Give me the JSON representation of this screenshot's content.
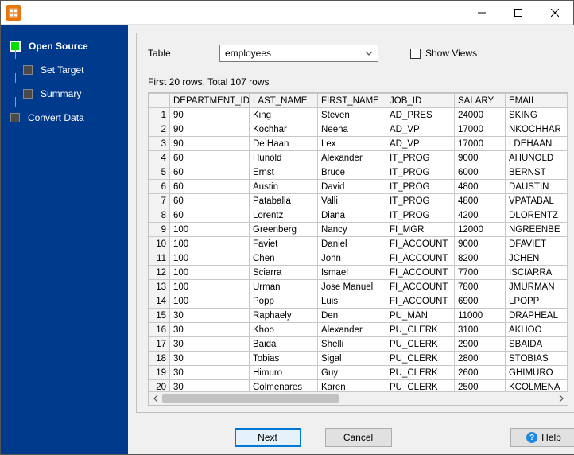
{
  "sidebar": {
    "steps": [
      {
        "label": "Open Source",
        "active": true,
        "indent": false
      },
      {
        "label": "Set Target",
        "active": false,
        "indent": true
      },
      {
        "label": "Summary",
        "active": false,
        "indent": true
      },
      {
        "label": "Convert Data",
        "active": false,
        "indent": false
      }
    ]
  },
  "controls": {
    "table_label": "Table",
    "table_value": "employees",
    "show_views_label": "Show Views",
    "show_views_checked": false
  },
  "status": {
    "rows_summary": "First 20 rows, Total 107 rows"
  },
  "grid": {
    "columns": [
      "DEPARTMENT_ID",
      "LAST_NAME",
      "FIRST_NAME",
      "JOB_ID",
      "SALARY",
      "EMAIL"
    ],
    "rows": [
      [
        "90",
        "King",
        "Steven",
        "AD_PRES",
        "24000",
        "SKING"
      ],
      [
        "90",
        "Kochhar",
        "Neena",
        "AD_VP",
        "17000",
        "NKOCHHAR"
      ],
      [
        "90",
        "De Haan",
        "Lex",
        "AD_VP",
        "17000",
        "LDEHAAN"
      ],
      [
        "60",
        "Hunold",
        "Alexander",
        "IT_PROG",
        "9000",
        "AHUNOLD"
      ],
      [
        "60",
        "Ernst",
        "Bruce",
        "IT_PROG",
        "6000",
        "BERNST"
      ],
      [
        "60",
        "Austin",
        "David",
        "IT_PROG",
        "4800",
        "DAUSTIN"
      ],
      [
        "60",
        "Pataballa",
        "Valli",
        "IT_PROG",
        "4800",
        "VPATABAL"
      ],
      [
        "60",
        "Lorentz",
        "Diana",
        "IT_PROG",
        "4200",
        "DLORENTZ"
      ],
      [
        "100",
        "Greenberg",
        "Nancy",
        "FI_MGR",
        "12000",
        "NGREENBE"
      ],
      [
        "100",
        "Faviet",
        "Daniel",
        "FI_ACCOUNT",
        "9000",
        "DFAVIET"
      ],
      [
        "100",
        "Chen",
        "John",
        "FI_ACCOUNT",
        "8200",
        "JCHEN"
      ],
      [
        "100",
        "Sciarra",
        "Ismael",
        "FI_ACCOUNT",
        "7700",
        "ISCIARRA"
      ],
      [
        "100",
        "Urman",
        "Jose Manuel",
        "FI_ACCOUNT",
        "7800",
        "JMURMAN"
      ],
      [
        "100",
        "Popp",
        "Luis",
        "FI_ACCOUNT",
        "6900",
        "LPOPP"
      ],
      [
        "30",
        "Raphaely",
        "Den",
        "PU_MAN",
        "11000",
        "DRAPHEAL"
      ],
      [
        "30",
        "Khoo",
        "Alexander",
        "PU_CLERK",
        "3100",
        "AKHOO"
      ],
      [
        "30",
        "Baida",
        "Shelli",
        "PU_CLERK",
        "2900",
        "SBAIDA"
      ],
      [
        "30",
        "Tobias",
        "Sigal",
        "PU_CLERK",
        "2800",
        "STOBIAS"
      ],
      [
        "30",
        "Himuro",
        "Guy",
        "PU_CLERK",
        "2600",
        "GHIMURO"
      ],
      [
        "30",
        "Colmenares",
        "Karen",
        "PU_CLERK",
        "2500",
        "KCOLMENA"
      ]
    ]
  },
  "buttons": {
    "next": "Next",
    "cancel": "Cancel",
    "help": "Help"
  }
}
